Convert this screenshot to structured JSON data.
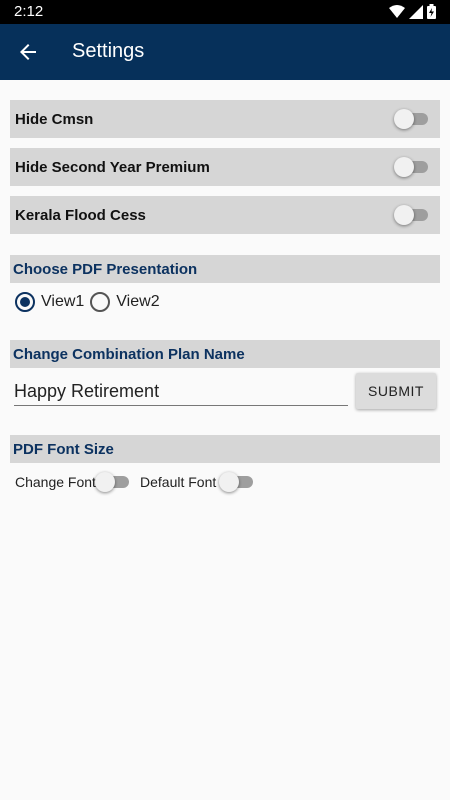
{
  "status_bar": {
    "time": "2:12"
  },
  "app_bar": {
    "title": "Settings"
  },
  "toggles": [
    {
      "label": "Hide Cmsn",
      "on": false
    },
    {
      "label": "Hide Second Year Premium",
      "on": false
    },
    {
      "label": "Kerala Flood Cess",
      "on": false
    }
  ],
  "pdf_presentation": {
    "header": "Choose PDF Presentation",
    "options": [
      {
        "label": "View1",
        "selected": true
      },
      {
        "label": "View2",
        "selected": false
      }
    ]
  },
  "combination_plan": {
    "header": "Change Combination Plan Name",
    "value": "Happy Retirement",
    "submit_label": "SUBMIT"
  },
  "pdf_font": {
    "header": "PDF Font Size",
    "change_font_label": "Change Font",
    "default_font_label": "Default Font",
    "change_font_on": false,
    "default_font_on": false
  },
  "colors": {
    "app_bar": "#06305a",
    "section_text": "#0c3260",
    "row_background": "#d6d6d6"
  }
}
